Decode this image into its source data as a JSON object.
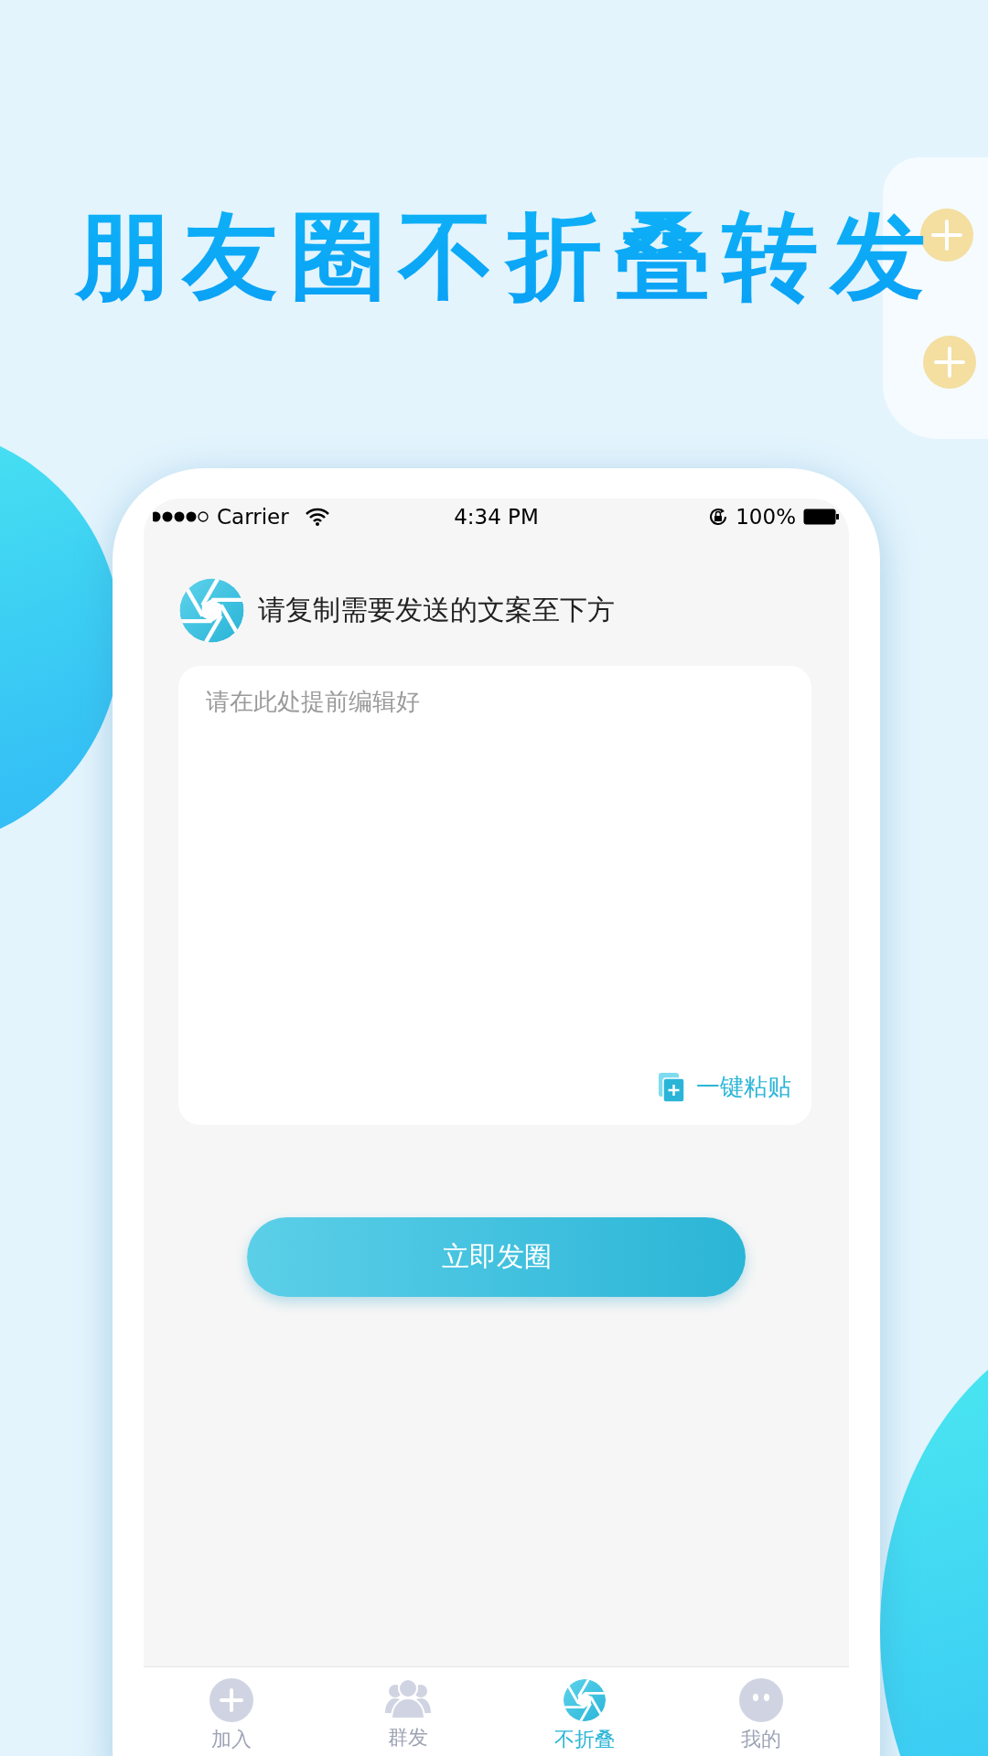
{
  "headline": "朋友圈不折叠转发",
  "status_bar": {
    "carrier": "Carrier",
    "time": "4:34 PM",
    "battery": "100%"
  },
  "prompt": "请复制需要发送的文案至下方",
  "editor": {
    "placeholder": "请在此处提前编辑好",
    "paste_label": "一键粘贴"
  },
  "submit_button": "立即发圈",
  "tabs": [
    {
      "label": "加入",
      "kind": "plus",
      "selected": false
    },
    {
      "label": "群发",
      "kind": "group",
      "selected": false
    },
    {
      "label": "不折叠",
      "kind": "shutter",
      "selected": true
    },
    {
      "label": "我的",
      "kind": "face",
      "selected": false
    }
  ]
}
